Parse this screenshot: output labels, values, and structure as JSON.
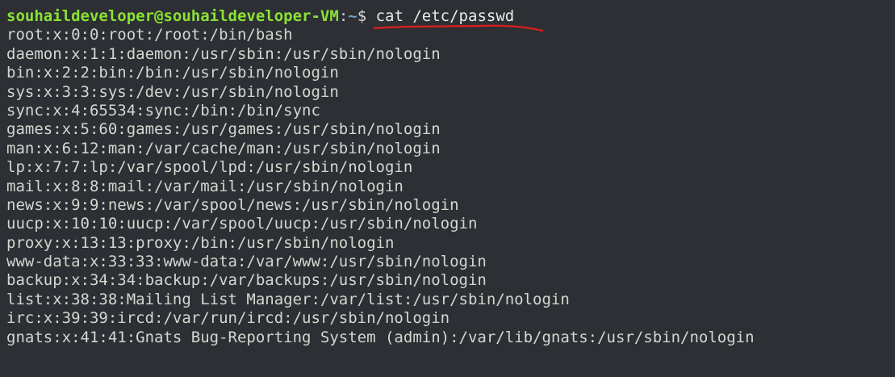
{
  "prompt": {
    "user_host": "souhaildeveloper@souhaildeveloper-VM",
    "colon": ":",
    "path": "~",
    "dollar": "$ ",
    "command": "cat /etc/passwd"
  },
  "annotation": {
    "underline_color": "#d41f1f"
  },
  "output_lines": [
    "root:x:0:0:root:/root:/bin/bash",
    "daemon:x:1:1:daemon:/usr/sbin:/usr/sbin/nologin",
    "bin:x:2:2:bin:/bin:/usr/sbin/nologin",
    "sys:x:3:3:sys:/dev:/usr/sbin/nologin",
    "sync:x:4:65534:sync:/bin:/bin/sync",
    "games:x:5:60:games:/usr/games:/usr/sbin/nologin",
    "man:x:6:12:man:/var/cache/man:/usr/sbin/nologin",
    "lp:x:7:7:lp:/var/spool/lpd:/usr/sbin/nologin",
    "mail:x:8:8:mail:/var/mail:/usr/sbin/nologin",
    "news:x:9:9:news:/var/spool/news:/usr/sbin/nologin",
    "uucp:x:10:10:uucp:/var/spool/uucp:/usr/sbin/nologin",
    "proxy:x:13:13:proxy:/bin:/usr/sbin/nologin",
    "www-data:x:33:33:www-data:/var/www:/usr/sbin/nologin",
    "backup:x:34:34:backup:/var/backups:/usr/sbin/nologin",
    "list:x:38:38:Mailing List Manager:/var/list:/usr/sbin/nologin",
    "irc:x:39:39:ircd:/var/run/ircd:/usr/sbin/nologin",
    "gnats:x:41:41:Gnats Bug-Reporting System (admin):/var/lib/gnats:/usr/sbin/nologin"
  ]
}
